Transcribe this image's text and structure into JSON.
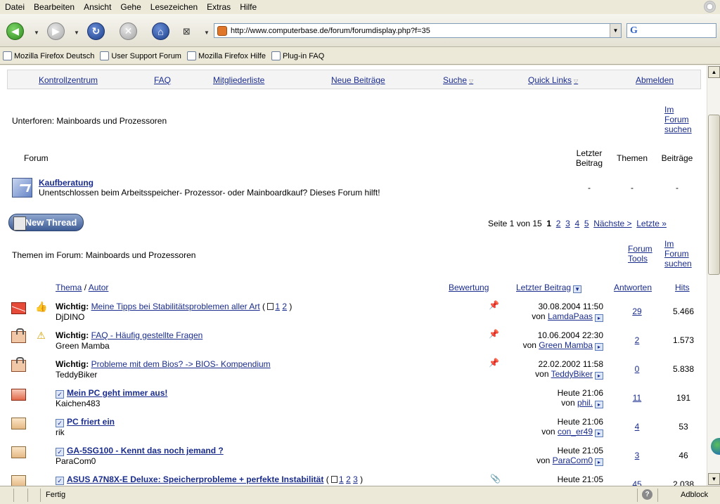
{
  "menu": [
    "Datei",
    "Bearbeiten",
    "Ansicht",
    "Gehe",
    "Lesezeichen",
    "Extras",
    "Hilfe"
  ],
  "browser": {
    "url": "http://www.computerbase.de/forum/forumdisplay.php?f=35",
    "search_engine_glyph": "G"
  },
  "bookmarks": [
    "Mozilla Firefox Deutsch",
    "User Support Forum",
    "Mozilla Firefox Hilfe",
    "Plug-in FAQ"
  ],
  "forum_nav": {
    "kontrollzentrum": "Kontrollzentrum",
    "faq": "FAQ",
    "mitgliederliste": "Mitgliederliste",
    "neue_beitraege": "Neue Beiträge",
    "suche": "Suche",
    "quick_links": "Quick Links",
    "abmelden": "Abmelden"
  },
  "subforums": {
    "title": "Unterforen: Mainboards und Prozessoren",
    "search_link": [
      "Im",
      "Forum",
      "suchen"
    ],
    "col_forum": "Forum",
    "col_last": [
      "Letzter",
      "Beitrag"
    ],
    "col_threads": "Themen",
    "col_posts": "Beiträge",
    "item": {
      "name": "Kaufberatung",
      "desc": "Unentschlossen beim Arbeitsspeicher- Prozessor- oder Mainboardkauf? Dieses Forum hilft!",
      "last": "-",
      "threads": "-",
      "posts": "-"
    }
  },
  "new_thread_label": "New Thread",
  "pagination": {
    "label": "Seite 1 von 15",
    "current": "1",
    "pages": [
      "2",
      "3",
      "4",
      "5"
    ],
    "next": "Nächste >",
    "last": "Letzte »"
  },
  "threads_section": {
    "title": "Themen im Forum: Mainboards und Prozessoren",
    "tools_link": [
      "Forum",
      "Tools"
    ],
    "search_link": [
      "Im",
      "Forum",
      "suchen"
    ],
    "col_thema": "Thema",
    "col_slash": " / ",
    "col_autor": "Autor",
    "col_rating": "Bewertung",
    "col_last": "Letzter Beitrag",
    "col_replies": "Antworten",
    "col_hits": "Hits"
  },
  "threads": [
    {
      "prefix": "Wichtig:",
      "title": "Meine Tipps bei Stabilitätsproblemen aller Art",
      "pages": [
        "1",
        "2"
      ],
      "author": "DjDINO",
      "date": "30.08.2004 11:50",
      "von": "von",
      "last_user": "LamdaPaas",
      "replies": "29",
      "hits": "5.466"
    },
    {
      "prefix": "Wichtig:",
      "title": "FAQ - Häufig gestellte Fragen",
      "pages": [],
      "author": "Green Mamba",
      "date": "10.06.2004 22:30",
      "von": "von",
      "last_user": "Green Mamba",
      "replies": "2",
      "hits": "1.573"
    },
    {
      "prefix": "Wichtig:",
      "title": "Probleme mit dem Bios? -> BIOS- Kompendium",
      "pages": [],
      "author": "TeddyBiker",
      "date": "22.02.2002 11:58",
      "von": "von",
      "last_user": "TeddyBiker",
      "replies": "0",
      "hits": "5.838"
    },
    {
      "prefix": "",
      "title": "Mein PC geht immer aus!",
      "pages": [],
      "author": "Kaichen483",
      "date": "Heute 21:06",
      "von": "von",
      "last_user": "phil.",
      "replies": "11",
      "hits": "191"
    },
    {
      "prefix": "",
      "title": "PC friert ein",
      "pages": [],
      "author": "rik",
      "date": "Heute 21:06",
      "von": "von",
      "last_user": "con_er49",
      "replies": "4",
      "hits": "53"
    },
    {
      "prefix": "",
      "title": "GA-5SG100 - Kennt das noch jemand ?",
      "pages": [],
      "author": "ParaCom0",
      "date": "Heute 21:05",
      "von": "von",
      "last_user": "ParaCom0",
      "replies": "3",
      "hits": "46"
    },
    {
      "prefix": "",
      "title": "ASUS A7N8X-E Deluxe: Speicherprobleme + perfekte Instabilität",
      "pages": [
        "1",
        "2",
        "3"
      ],
      "author": "",
      "date": "Heute 21:05",
      "von": "",
      "last_user": "",
      "replies": "45",
      "hits": "2.038"
    }
  ],
  "status": {
    "text": "Fertig",
    "help_glyph": "?",
    "adblock": "Adblock"
  }
}
